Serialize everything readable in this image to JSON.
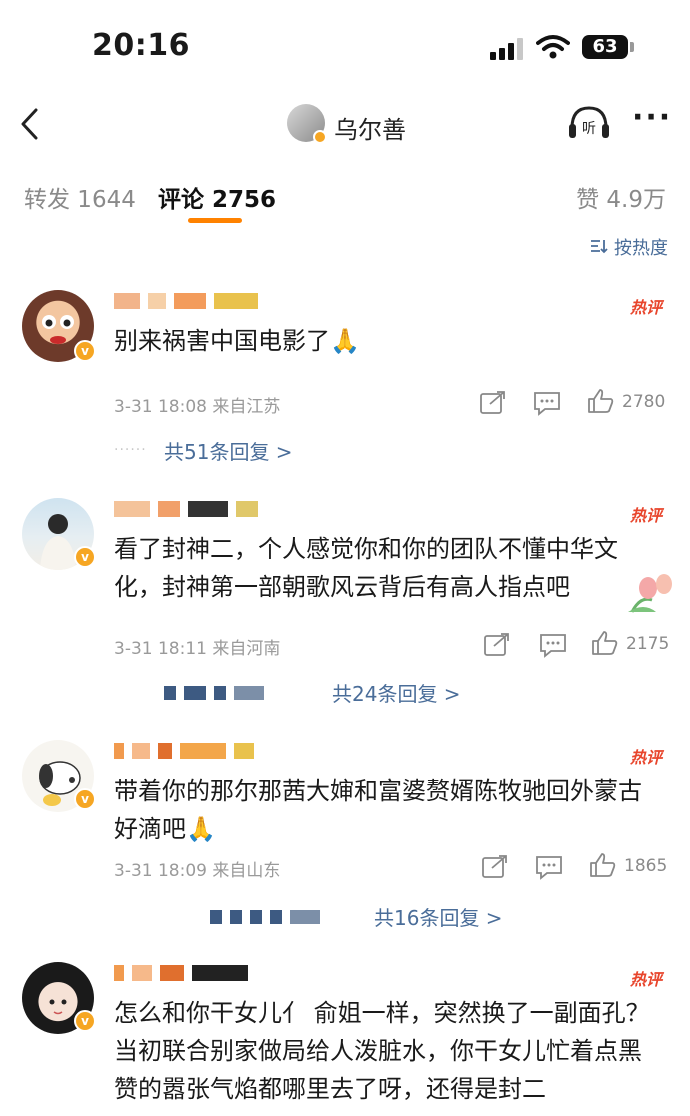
{
  "status": {
    "time": "20:16",
    "battery": "63"
  },
  "nav": {
    "title": "乌尔善"
  },
  "tabs": {
    "repost": "转发 1644",
    "comment": "评论 2756",
    "like": "赞 4.9万"
  },
  "sort": {
    "label": "按热度"
  },
  "comments": [
    {
      "hot": "热评",
      "text": "别来祸害中国电影了🙏",
      "time": "3-31 18:08",
      "location": "来自江苏",
      "likes": "2780",
      "replies": "共51条回复 >"
    },
    {
      "hot": "热评",
      "text": "看了封神二，个人感觉你和你的团队不懂中华文化，封神第一部朝歌风云背后有高人指点吧",
      "time": "3-31 18:11",
      "location": "来自河南",
      "likes": "2175",
      "replies": "共24条回复 >"
    },
    {
      "hot": "热评",
      "text": "带着你的那尔那茜大婶和富婆赘婿陈牧驰回外蒙古好滴吧🙏",
      "time": "3-31 18:09",
      "location": "来自山东",
      "likes": "1865",
      "replies": "共16条回复 >"
    },
    {
      "hot": "热评",
      "text": "怎么和你干女儿亻 俞姐一样，突然换了一副面孔？当初联合别家做局给人泼脏水，你干女儿忙着点黑赞的嚣张气焰都哪里去了呀，还得是封二"
    }
  ]
}
